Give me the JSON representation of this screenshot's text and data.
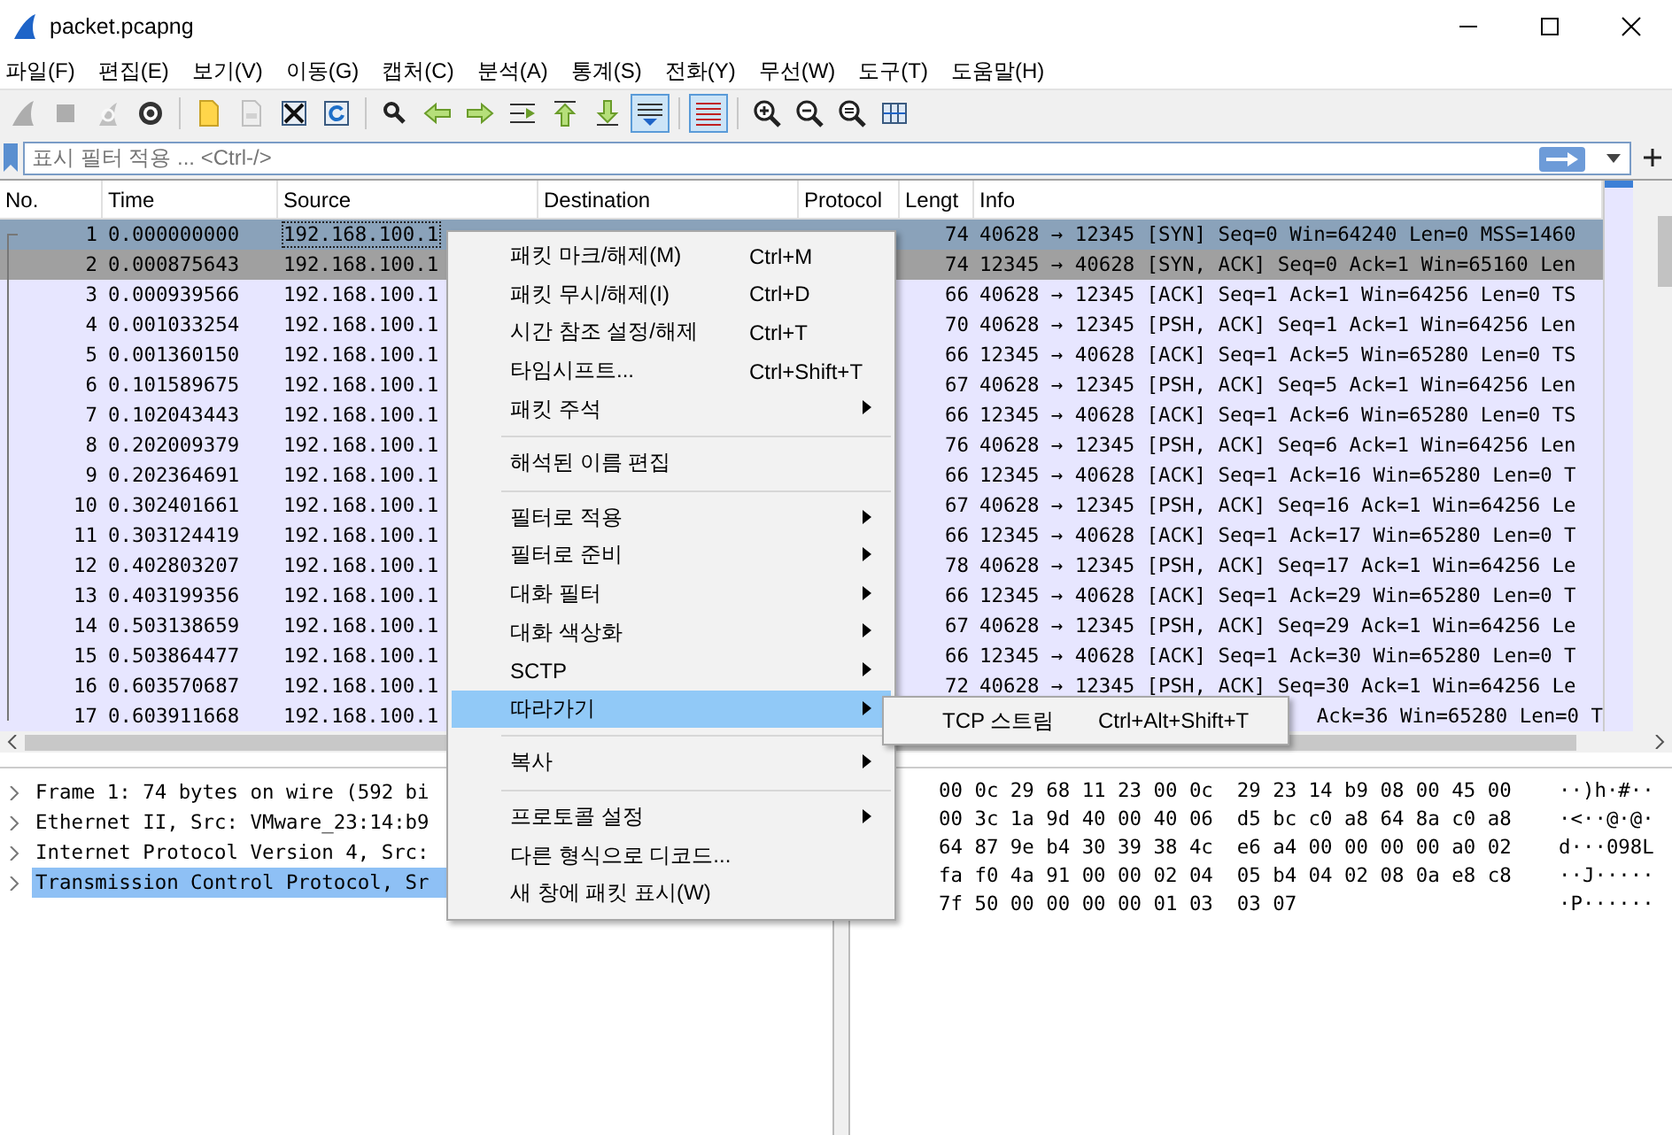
{
  "window": {
    "title": "packet.pcapng"
  },
  "menubar": [
    "파일(F)",
    "편집(E)",
    "보기(V)",
    "이동(G)",
    "캡처(C)",
    "분석(A)",
    "통계(S)",
    "전화(Y)",
    "무선(W)",
    "도구(T)",
    "도움말(H)"
  ],
  "toolbar": [
    {
      "items": [
        {
          "kind": "fin",
          "disabled": true,
          "pressed": false
        },
        {
          "kind": "stop",
          "disabled": true,
          "pressed": false
        },
        {
          "kind": "restart",
          "disabled": true,
          "pressed": false
        },
        {
          "kind": "options",
          "disabled": false,
          "pressed": false
        }
      ]
    },
    {
      "items": [
        {
          "kind": "open",
          "disabled": false,
          "pressed": false
        },
        {
          "kind": "save",
          "disabled": true,
          "pressed": false
        },
        {
          "kind": "close",
          "disabled": false,
          "pressed": false
        },
        {
          "kind": "reload",
          "disabled": false,
          "pressed": false
        }
      ]
    },
    {
      "items": [
        {
          "kind": "find",
          "disabled": false,
          "pressed": false
        },
        {
          "kind": "back",
          "disabled": false,
          "pressed": false
        },
        {
          "kind": "forward",
          "disabled": false,
          "pressed": false
        },
        {
          "kind": "goto",
          "disabled": false,
          "pressed": false
        },
        {
          "kind": "first",
          "disabled": false,
          "pressed": false
        },
        {
          "kind": "last",
          "disabled": false,
          "pressed": false
        },
        {
          "kind": "autoscroll",
          "disabled": false,
          "pressed": true
        }
      ]
    },
    {
      "items": [
        {
          "kind": "colorize",
          "disabled": false,
          "pressed": true
        }
      ]
    },
    {
      "items": [
        {
          "kind": "zoomin",
          "disabled": false,
          "pressed": false
        },
        {
          "kind": "zoomout",
          "disabled": false,
          "pressed": false
        },
        {
          "kind": "zoomreset",
          "disabled": false,
          "pressed": false
        },
        {
          "kind": "resize",
          "disabled": false,
          "pressed": false
        }
      ]
    }
  ],
  "filter": {
    "placeholder": "표시 필터 적용 ... <Ctrl-/>"
  },
  "packet_list": {
    "columns": [
      "No.",
      "Time",
      "Source",
      "Destination",
      "Protocol",
      "Lengt",
      "Info"
    ],
    "rows": [
      {
        "no": "1",
        "time": "0.000000000",
        "source": "192.168.100.1",
        "length": "74",
        "info": "40628 → 12345 [SYN] Seq=0 Win=64240 Len=0 MSS=1460",
        "selected": true
      },
      {
        "no": "2",
        "time": "0.000875643",
        "source": "192.168.100.1",
        "length": "74",
        "info": "12345 → 40628 [SYN, ACK] Seq=0 Ack=1 Win=65160 Len",
        "selected": false,
        "color": "#a0a0a0"
      },
      {
        "no": "3",
        "time": "0.000939566",
        "source": "192.168.100.1",
        "length": "66",
        "info": "40628 → 12345 [ACK] Seq=1 Ack=1 Win=64256 Len=0 TS",
        "selected": false,
        "color": "#e7e6ff"
      },
      {
        "no": "4",
        "time": "0.001033254",
        "source": "192.168.100.1",
        "length": "70",
        "info": "40628 → 12345 [PSH, ACK] Seq=1 Ack=1 Win=64256 Len",
        "selected": false,
        "color": "#e7e6ff"
      },
      {
        "no": "5",
        "time": "0.001360150",
        "source": "192.168.100.1",
        "length": "66",
        "info": "12345 → 40628 [ACK] Seq=1 Ack=5 Win=65280 Len=0 TS",
        "selected": false,
        "color": "#e7e6ff"
      },
      {
        "no": "6",
        "time": "0.101589675",
        "source": "192.168.100.1",
        "length": "67",
        "info": "40628 → 12345 [PSH, ACK] Seq=5 Ack=1 Win=64256 Len",
        "selected": false,
        "color": "#e7e6ff"
      },
      {
        "no": "7",
        "time": "0.102043443",
        "source": "192.168.100.1",
        "length": "66",
        "info": "12345 → 40628 [ACK] Seq=1 Ack=6 Win=65280 Len=0 TS",
        "selected": false,
        "color": "#e7e6ff"
      },
      {
        "no": "8",
        "time": "0.202009379",
        "source": "192.168.100.1",
        "length": "76",
        "info": "40628 → 12345 [PSH, ACK] Seq=6 Ack=1 Win=64256 Len",
        "selected": false,
        "color": "#e7e6ff"
      },
      {
        "no": "9",
        "time": "0.202364691",
        "source": "192.168.100.1",
        "length": "66",
        "info": "12345 → 40628 [ACK] Seq=1 Ack=16 Win=65280 Len=0 T",
        "selected": false,
        "color": "#e7e6ff"
      },
      {
        "no": "10",
        "time": "0.302401661",
        "source": "192.168.100.1",
        "length": "67",
        "info": "40628 → 12345 [PSH, ACK] Seq=16 Ack=1 Win=64256 Le",
        "selected": false,
        "color": "#e7e6ff"
      },
      {
        "no": "11",
        "time": "0.303124419",
        "source": "192.168.100.1",
        "length": "66",
        "info": "12345 → 40628 [ACK] Seq=1 Ack=17 Win=65280 Len=0 T",
        "selected": false,
        "color": "#e7e6ff"
      },
      {
        "no": "12",
        "time": "0.402803207",
        "source": "192.168.100.1",
        "length": "78",
        "info": "40628 → 12345 [PSH, ACK] Seq=17 Ack=1 Win=64256 Le",
        "selected": false,
        "color": "#e7e6ff"
      },
      {
        "no": "13",
        "time": "0.403199356",
        "source": "192.168.100.1",
        "length": "66",
        "info": "12345 → 40628 [ACK] Seq=1 Ack=29 Win=65280 Len=0 T",
        "selected": false,
        "color": "#e7e6ff"
      },
      {
        "no": "14",
        "time": "0.503138659",
        "source": "192.168.100.1",
        "length": "67",
        "info": "40628 → 12345 [PSH, ACK] Seq=29 Ack=1 Win=64256 Le",
        "selected": false,
        "color": "#e7e6ff"
      },
      {
        "no": "15",
        "time": "0.503864477",
        "source": "192.168.100.1",
        "length": "66",
        "info": "12345 → 40628 [ACK] Seq=1 Ack=30 Win=65280 Len=0 T",
        "selected": false,
        "color": "#e7e6ff"
      },
      {
        "no": "16",
        "time": "0.603570687",
        "source": "192.168.100.1",
        "length": "72",
        "info": "40628 → 12345 [PSH, ACK] Seq=30 Ack=1 Win=64256 Le",
        "selected": false,
        "color": "#e7e6ff"
      },
      {
        "no": "17",
        "time": "0.603911668",
        "source": "192.168.100.1",
        "info": "Ack=36 Win=65280 Len=0 T",
        "selected": false,
        "color": "#e7e6ff"
      }
    ]
  },
  "context_menu": [
    {
      "kind": "item",
      "label": "패킷 마크/해제(M)",
      "shortcut": "Ctrl+M",
      "submenu": false,
      "selected": false
    },
    {
      "kind": "item",
      "label": "패킷 무시/해제(I)",
      "shortcut": "Ctrl+D",
      "submenu": false,
      "selected": false
    },
    {
      "kind": "item",
      "label": "시간 참조 설정/해제",
      "shortcut": "Ctrl+T",
      "submenu": false,
      "selected": false
    },
    {
      "kind": "item",
      "label": "타임시프트...",
      "shortcut": "Ctrl+Shift+T",
      "submenu": false,
      "selected": false
    },
    {
      "kind": "item",
      "label": "패킷 주석",
      "submenu": true,
      "selected": false
    },
    {
      "kind": "separator"
    },
    {
      "kind": "item",
      "label": "해석된 이름 편집",
      "submenu": false,
      "selected": false
    },
    {
      "kind": "separator"
    },
    {
      "kind": "item",
      "label": "필터로 적용",
      "submenu": true,
      "selected": false
    },
    {
      "kind": "item",
      "label": "필터로 준비",
      "submenu": true,
      "selected": false
    },
    {
      "kind": "item",
      "label": "대화 필터",
      "submenu": true,
      "selected": false
    },
    {
      "kind": "item",
      "label": "대화 색상화",
      "submenu": true,
      "selected": false
    },
    {
      "kind": "item",
      "label": "SCTP",
      "submenu": true,
      "selected": false
    },
    {
      "kind": "item",
      "label": "따라가기",
      "submenu": true,
      "selected": true,
      "submenu_items": [
        {
          "label": "TCP 스트림",
          "shortcut": "Ctrl+Alt+Shift+T"
        }
      ]
    },
    {
      "kind": "separator"
    },
    {
      "kind": "item",
      "label": "복사",
      "submenu": true,
      "selected": false
    },
    {
      "kind": "separator"
    },
    {
      "kind": "item",
      "label": "프로토콜 설정",
      "submenu": true,
      "selected": false
    },
    {
      "kind": "item",
      "label": "다른 형식으로 디코드...",
      "submenu": false,
      "selected": false
    },
    {
      "kind": "item",
      "label": "새 창에 패킷 표시(W)",
      "submenu": false,
      "selected": false
    }
  ],
  "packet_details": [
    {
      "label": "Frame 1: 74 bytes on wire (592 bi",
      "expanded": false,
      "selected": false
    },
    {
      "label": "Ethernet II, Src: VMware_23:14:b9",
      "expanded": false,
      "selected": false
    },
    {
      "label": "Internet Protocol Version 4, Src:",
      "expanded": false,
      "selected": false
    },
    {
      "label": "Transmission Control Protocol, Sr",
      "expanded": false,
      "selected": true
    }
  ],
  "packet_bytes": [
    {
      "hex": "00 0c 29 68 11 23 00 0c  29 23 14 b9 08 00 45 00",
      "ascii": "··)h·#··"
    },
    {
      "hex": "00 3c 1a 9d 40 00 40 06  d5 bc c0 a8 64 8a c0 a8",
      "ascii": "·<··@·@·"
    },
    {
      "hex": "64 87 9e b4 30 39 38 4c  e6 a4 00 00 00 00 a0 02",
      "ascii": "d···098L"
    },
    {
      "hex": "fa f0 4a 91 00 00 02 04  05 b4 04 02 08 0a e8 c8",
      "ascii": "··J·····"
    },
    {
      "hex": "7f 50 00 00 00 00 01 03  03 07",
      "ascii": "·P······"
    }
  ]
}
